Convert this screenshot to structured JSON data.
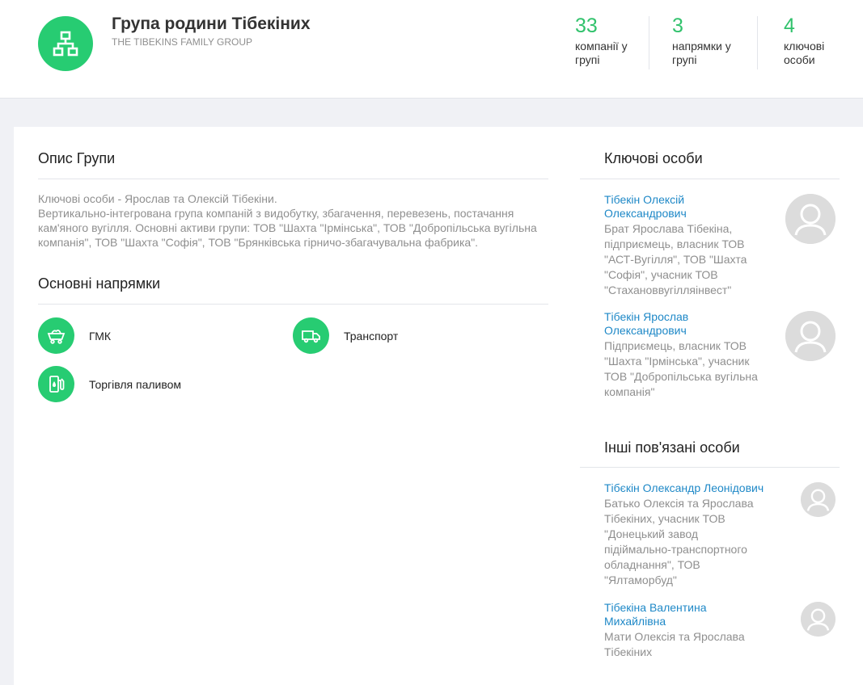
{
  "header": {
    "title": "Група родини Тібекіних",
    "subtitle": "THE TIBEKINS FAMILY GROUP",
    "stats": [
      {
        "num": "33",
        "label": "компанії у групі"
      },
      {
        "num": "3",
        "label": "напрямки у групі"
      },
      {
        "num": "4",
        "label": "ключові особи"
      }
    ]
  },
  "description": {
    "title": "Опис Групи",
    "line1": "Ключові особи - Ярослав та Олексій Тібекіни.",
    "line2": "Вертикально-інтегрована група компаній з видобутку, збагачення, перевезень, постачання кам'яного вугілля. Основні активи групи: ТОВ \"Шахта \"Ірмінська\", ТОВ \"Добропільська вугільна компанія\", ТОВ \"Шахта \"Софія\", ТОВ \"Брянківська гірничо-збагачувальна фабрика\"."
  },
  "directions": {
    "title": "Основні напрямки",
    "items": [
      {
        "label": "ГМК",
        "icon": "mine-cart-icon"
      },
      {
        "label": "Транспорт",
        "icon": "truck-icon"
      },
      {
        "label": "Торгівля паливом",
        "icon": "fuel-pump-icon"
      }
    ]
  },
  "key_persons": {
    "title": "Ключові особи",
    "items": [
      {
        "name": "Тібекін Олексій Олександрович",
        "description": "Брат Ярослава Тібекіна, підприємець, власник ТОВ \"АСТ-Вугілля\", ТОВ \"Шахта \"Софія\", учасник ТОВ \"Стахановвугілляінвест\""
      },
      {
        "name": "Тібекін Ярослав Олександрович",
        "description": "Підприємець, власник ТОВ \"Шахта \"Ірмінська\", учасник ТОВ \"Добропільська вугільна компанія\""
      }
    ]
  },
  "other_persons": {
    "title": "Інші пов'язані особи",
    "items": [
      {
        "name": "Тібєкін Олександр Леонідович",
        "description": "Батько Олексія та Ярослава Тібекіних, учасник ТОВ \"Донецький завод підіймально-транспортного обладнання\", ТОВ \"Ялтаморбуд\""
      },
      {
        "name": "Тібекіна Валентина Михайлівна",
        "description": "Мати Олексія та Ярослава Тібекіних"
      }
    ]
  },
  "colors": {
    "accent": "#27cc72",
    "link": "#1e88c7",
    "muted": "#8f8f8f"
  }
}
